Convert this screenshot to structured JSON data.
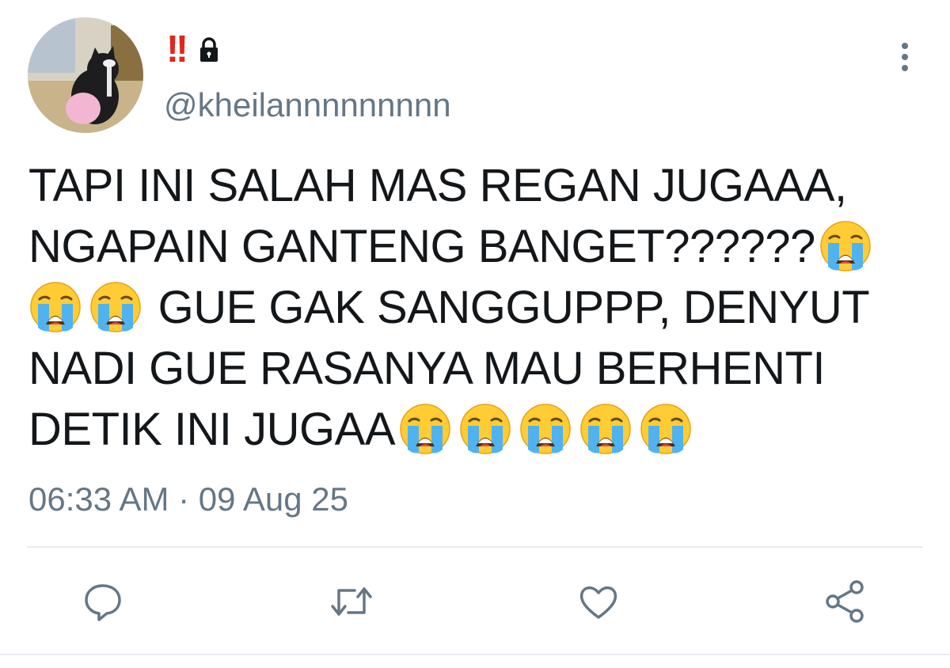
{
  "author": {
    "display_name_glyphs": "‼",
    "handle": "@kheilannnnnnnnn",
    "locked": true,
    "avatar_icon": "avatar-cat-photo"
  },
  "tweet": {
    "lines": [
      "TAPI INI SALAH MAS REGAN JUGAAA,",
      "NGAPAIN GANTENG BANGET??????",
      "GUE GAK SANGGUPPP, DENYUT",
      "NADI GUE RASANYA MAU BERHENTI",
      "DETIK INI JUGAA"
    ],
    "emoji": "loudly-crying-face",
    "timestamp": "06:33 AM · 09 Aug 25"
  },
  "actions": {
    "reply_icon": "reply-icon",
    "retweet_icon": "retweet-icon",
    "like_icon": "heart-icon",
    "share_icon": "share-icon",
    "more_icon": "more-options-icon"
  },
  "colors": {
    "text": "#14171a",
    "secondary": "#657786",
    "bang": "#e0271e",
    "divider": "#e6ecf0"
  }
}
